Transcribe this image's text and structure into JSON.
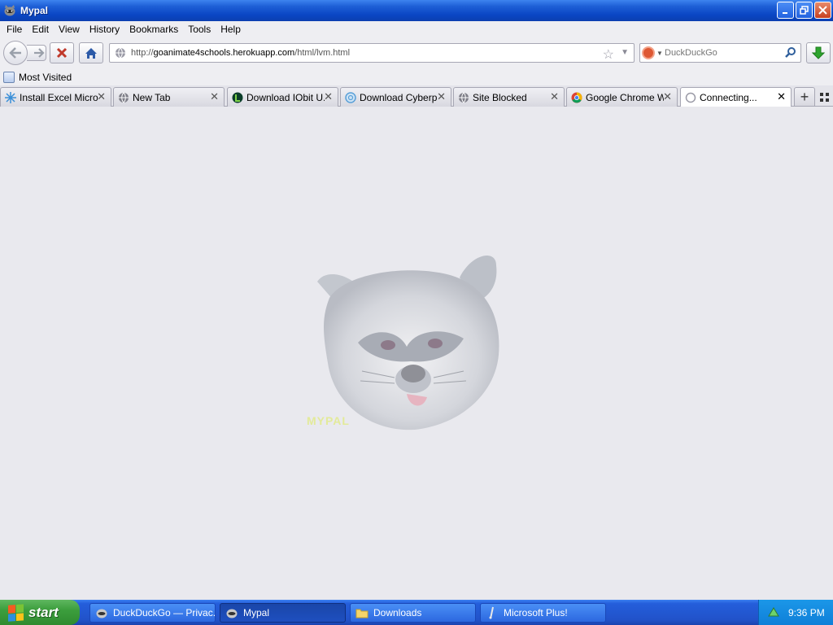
{
  "window": {
    "title": "Mypal"
  },
  "menu": [
    "File",
    "Edit",
    "View",
    "History",
    "Bookmarks",
    "Tools",
    "Help"
  ],
  "nav": {
    "url_scheme": "http://",
    "url_host": "goanimate4schools.herokuapp.com",
    "url_path": "/html/lvm.html",
    "search_placeholder": "DuckDuckGo"
  },
  "bookmarks": {
    "most_visited": "Most Visited"
  },
  "tabs": [
    {
      "label": "Install Excel Micro...",
      "icon": "sparkle-icon"
    },
    {
      "label": "New Tab",
      "icon": "globe-icon"
    },
    {
      "label": "Download IObit U...",
      "icon": "iobit-icon"
    },
    {
      "label": "Download Cyberp...",
      "icon": "cyberpunk-icon"
    },
    {
      "label": "Site Blocked",
      "icon": "globe-icon"
    },
    {
      "label": "Google Chrome W...",
      "icon": "chrome-icon"
    },
    {
      "label": "Connecting...",
      "icon": "loading-icon",
      "active": true
    }
  ],
  "content": {
    "mascot_text": "MYPAL"
  },
  "taskbar": {
    "start": "start",
    "tasks": [
      {
        "label": "DuckDuckGo — Privac...",
        "icon": "mypal-icon"
      },
      {
        "label": "Mypal",
        "icon": "mypal-icon",
        "active": true
      },
      {
        "label": "Downloads",
        "icon": "folder-icon"
      },
      {
        "label": "Microsoft Plus!",
        "icon": "plus-icon"
      }
    ],
    "clock": "9:36 PM"
  },
  "colors": {
    "titlebar": "#0a46c4",
    "taskbar": "#245edb",
    "start": "#3c9e3d",
    "content_bg": "#e9e9ee"
  }
}
